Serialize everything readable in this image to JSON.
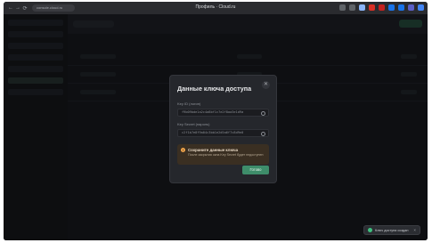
{
  "browser": {
    "tab_title": "Профиль · Cloud.ru",
    "url": "console.cloud.ru",
    "nav": {
      "back": "←",
      "forward": "→",
      "reload": "⟳"
    },
    "extension_colors": [
      "#5f6368",
      "#5f6368",
      "#8ab4f8",
      "#d93025",
      "#c5221f",
      "#1a73e8",
      "#1a73e8",
      "#5b5fc7",
      "#4285f4"
    ]
  },
  "modal": {
    "title": "Данные ключа доступа",
    "close_icon": "close-icon",
    "key_id_label": "Key ID (логин)",
    "key_id_value": "f9b09bde1a2c4a8bf1c7e2f8aa3e1d9a",
    "key_secret_label": "Key Secret (пароль)",
    "key_secret_value": "c2f1b7e8f9a04c3bb1e2d5a6f7c8d9e0",
    "warning_title": "Сохраните данные ключа",
    "warning_text": "После закрытия окна Key Secret будет недоступен",
    "ok_button": "Готово"
  },
  "toast": {
    "text": "Ключ доступа создан",
    "close": "×"
  }
}
